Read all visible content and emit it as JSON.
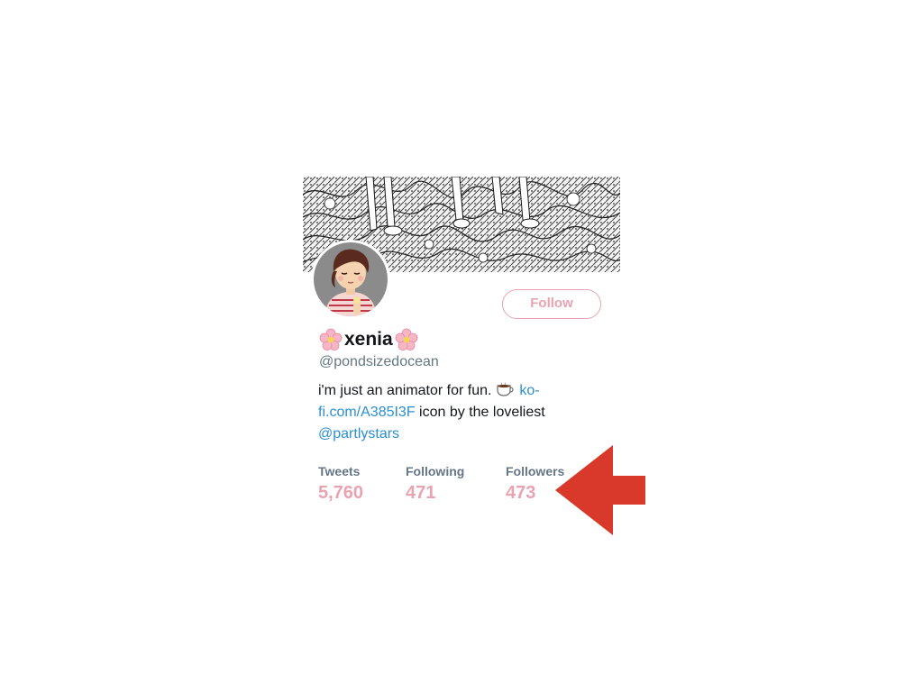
{
  "profile": {
    "display_name": "xenia",
    "handle": "@pondsizedocean",
    "follow_label": "Follow",
    "bio": {
      "line1_text": "i'm just an animator for fun. ",
      "link1_part1": "ko-",
      "link1_part2": "fi.com/A385I3F",
      "text2": " icon by the loveliest",
      "mention": "@partlystars"
    }
  },
  "stats": [
    {
      "label": "Tweets",
      "value": "5,760"
    },
    {
      "label": "Following",
      "value": "471"
    },
    {
      "label": "Followers",
      "value": "473"
    }
  ],
  "icons": {
    "name_prefix": "cherry-blossom-icon",
    "name_suffix": "cherry-blossom-icon",
    "bio_emoji": "hot-beverage-icon",
    "annotation": "red-arrow-icon"
  },
  "colors": {
    "accent_pink": "#e8a3b1",
    "link_blue": "#2b8fd0",
    "muted_gray": "#657786",
    "text_dark": "#14171a",
    "arrow_red": "#d9392b"
  }
}
